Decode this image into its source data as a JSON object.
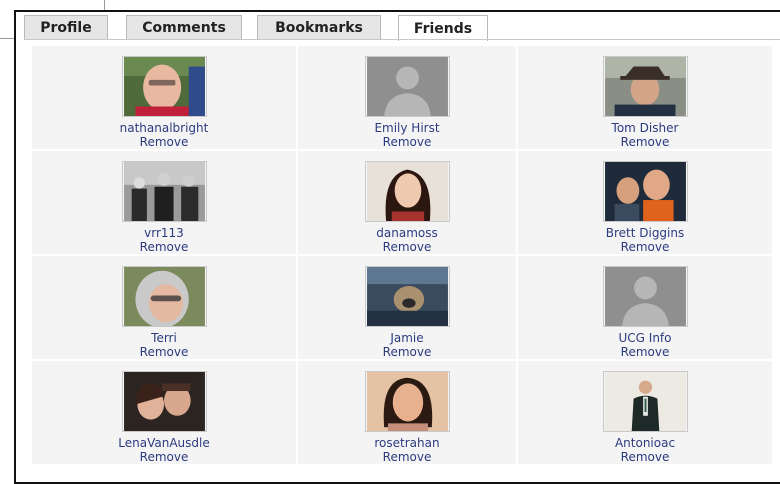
{
  "tabs": [
    {
      "label": "Profile"
    },
    {
      "label": "Comments"
    },
    {
      "label": "Bookmarks"
    },
    {
      "label": "Friends",
      "active": true
    }
  ],
  "friends": [
    {
      "name": "nathanalbright",
      "action": "Remove",
      "avatar": "photo-man-smiling"
    },
    {
      "name": "Emily Hirst",
      "action": "Remove",
      "avatar": "default-silhouette"
    },
    {
      "name": "Tom Disher",
      "action": "Remove",
      "avatar": "photo-man-with-hat"
    },
    {
      "name": "vrr113",
      "action": "Remove",
      "avatar": "photo-group-bw"
    },
    {
      "name": "danamoss",
      "action": "Remove",
      "avatar": "photo-woman-dark-hair"
    },
    {
      "name": "Brett Diggins",
      "action": "Remove",
      "avatar": "photo-two-men"
    },
    {
      "name": "Terri",
      "action": "Remove",
      "avatar": "photo-woman-glasses"
    },
    {
      "name": "Jamie",
      "action": "Remove",
      "avatar": "photo-dog-in-car"
    },
    {
      "name": "UCG Info",
      "action": "Remove",
      "avatar": "default-silhouette"
    },
    {
      "name": "LenaVanAusdle",
      "action": "Remove",
      "avatar": "photo-couple"
    },
    {
      "name": "rosetrahan",
      "action": "Remove",
      "avatar": "photo-woman-smiling"
    },
    {
      "name": "Antonioac",
      "action": "Remove",
      "avatar": "photo-man-in-suit"
    }
  ],
  "colors": {
    "link": "#2c3b80",
    "cell_bg": "#f4f4f4",
    "tab_bg": "#e6e6e6",
    "silhouette_bg": "#8f8f8f"
  }
}
